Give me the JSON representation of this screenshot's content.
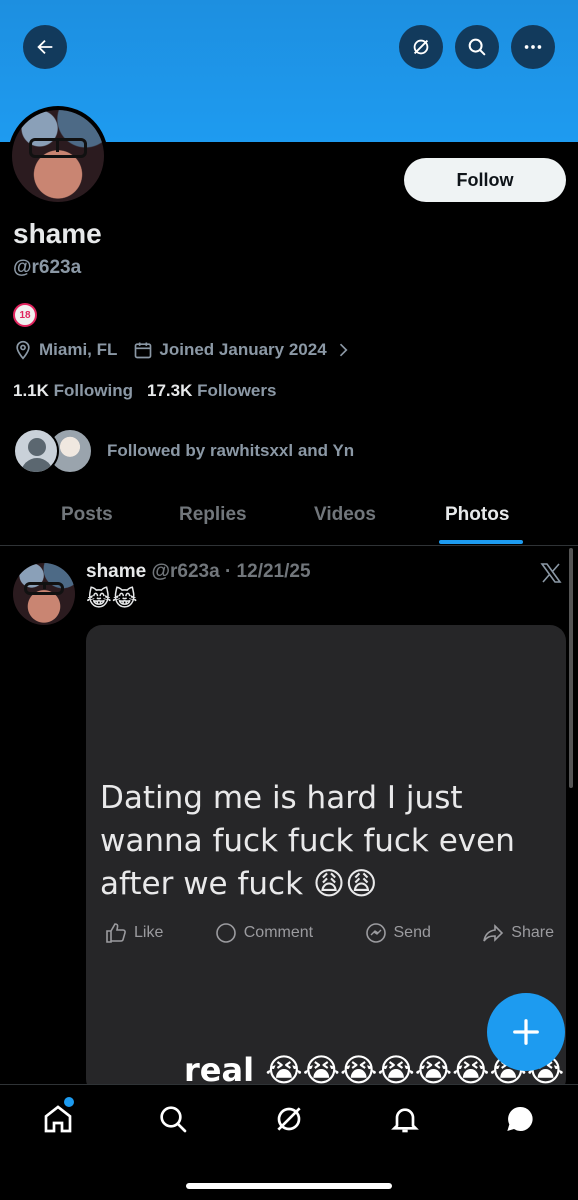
{
  "header": {
    "back_icon": "arrow-left-icon",
    "grok_icon": "grok-icon",
    "search_icon": "search-icon",
    "more_icon": "more-icon"
  },
  "profile": {
    "name": "shame",
    "handle": "@r623a",
    "bio_badge": "18",
    "location": "Miami, FL",
    "joined": "Joined January 2024",
    "following_count": "1.1K",
    "following_label": "Following",
    "followers_count": "17.3K",
    "followers_label": "Followers",
    "followed_by": "Followed by rawhitsxxl and Yn",
    "follow_label": "Follow"
  },
  "tabs": [
    {
      "label": "Posts"
    },
    {
      "label": "Replies"
    },
    {
      "label": "Videos"
    },
    {
      "label": "Photos",
      "active": true
    }
  ],
  "post": {
    "name": "shame",
    "meta": "@r623a · 12/21/25",
    "text": "😹😹",
    "media": {
      "line1": "Dating me is hard I just",
      "line2": "wanna fuck fuck fuck even",
      "line3": "after we fuck 😩😩",
      "actions": [
        "Like",
        "Comment",
        "Send",
        "Share"
      ],
      "bottom_text": "real 😭😭😭😭😭😭😭😭"
    }
  },
  "colors": {
    "accent": "#1d9bf0",
    "banner": "#1e9bf0",
    "background": "#000000"
  }
}
